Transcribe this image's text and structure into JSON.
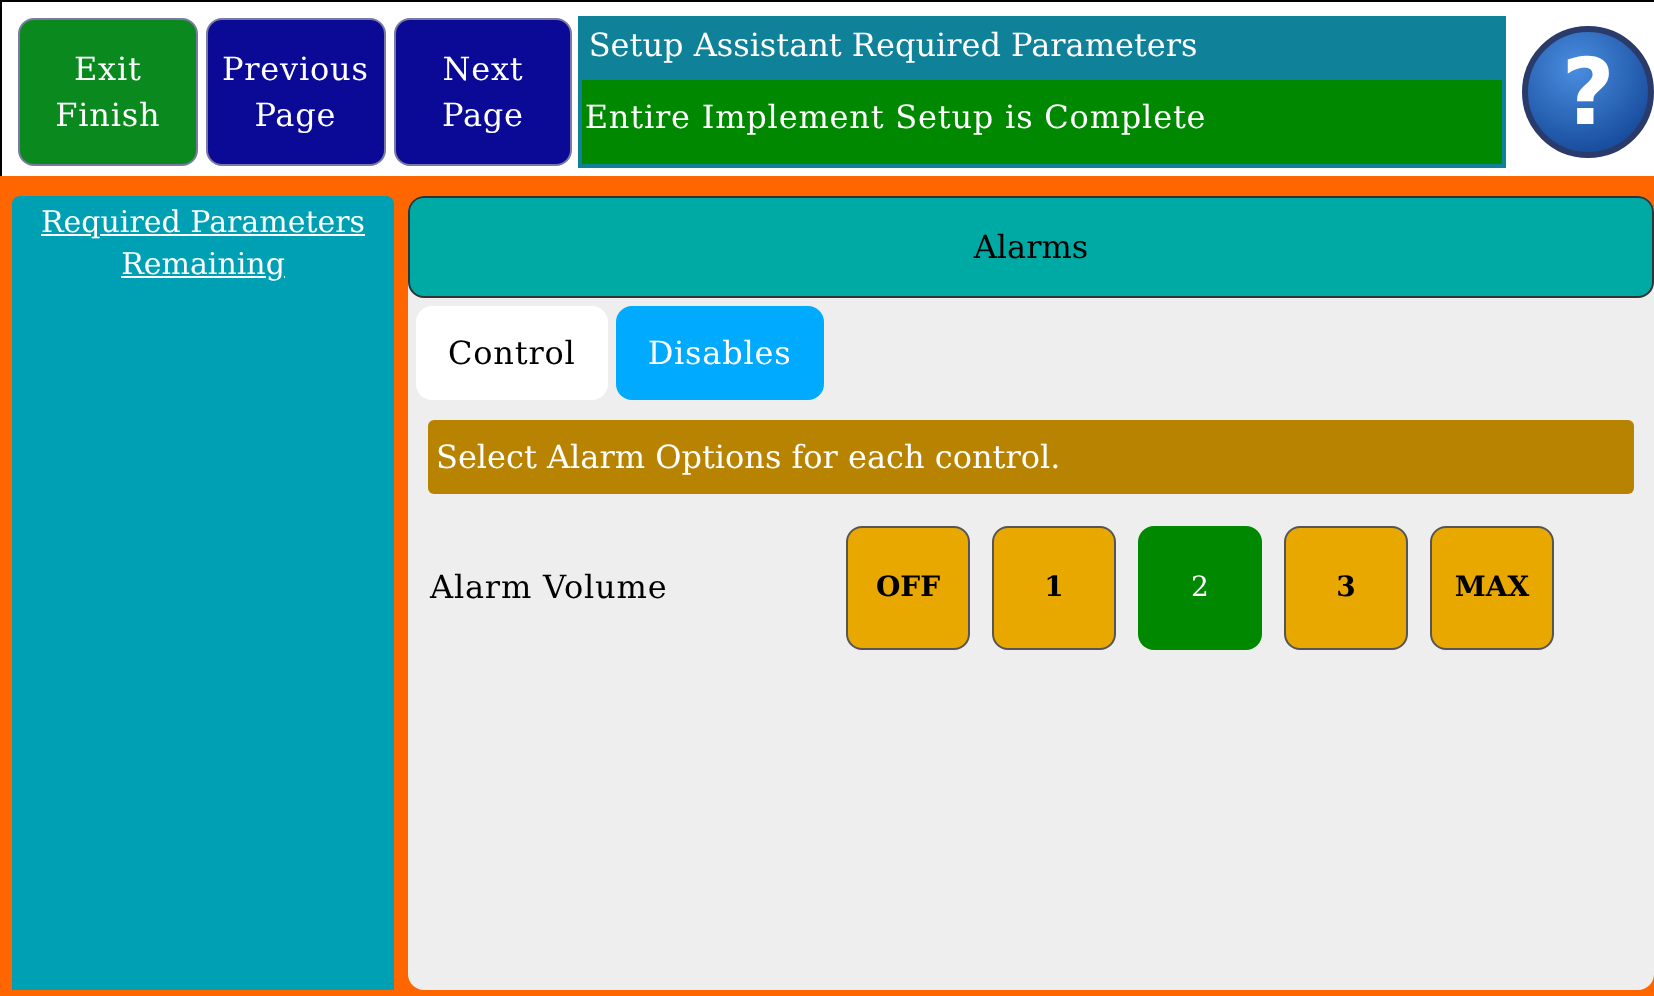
{
  "top_buttons": [
    {
      "label": "Exit\nFinish",
      "kind": "exit"
    },
    {
      "label": "Previous\nPage",
      "kind": "nav"
    },
    {
      "label": "Next\nPage",
      "kind": "nav"
    }
  ],
  "header": {
    "title": "Setup Assistant Required Parameters",
    "status": "Entire Implement Setup is Complete"
  },
  "help_button": {
    "label": "?"
  },
  "sidebar": {
    "link": "Required Parameters\nRemaining"
  },
  "panel": {
    "title": "Alarms",
    "tabs": [
      {
        "label": "Control",
        "selected": true
      },
      {
        "label": "Disables",
        "selected": false
      }
    ],
    "instruction": "Select Alarm Options for each control.",
    "settings": [
      {
        "label": "Alarm Volume",
        "options": [
          {
            "label": "OFF",
            "selected": false
          },
          {
            "label": "1",
            "selected": false
          },
          {
            "label": "2",
            "selected": true
          },
          {
            "label": "3",
            "selected": false
          },
          {
            "label": "MAX",
            "selected": false
          }
        ]
      }
    ]
  }
}
